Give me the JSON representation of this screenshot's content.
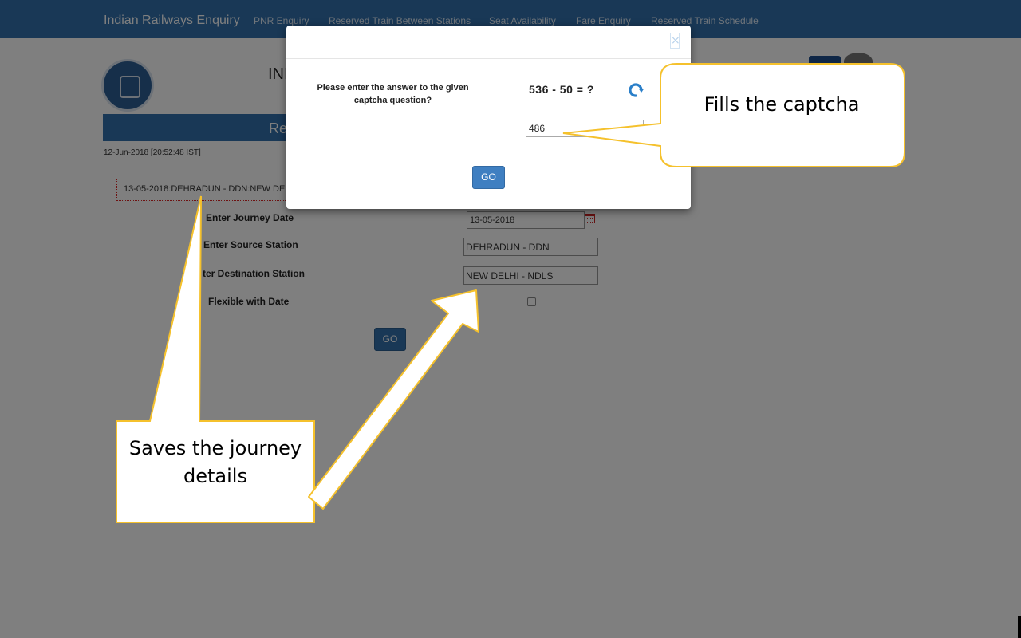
{
  "navbar": {
    "brand": "Indian Railways Enquiry",
    "links": [
      "PNR Enquiry",
      "Reserved Train Between Stations",
      "Seat Availability",
      "Fare Enquiry",
      "Reserved Train Schedule"
    ]
  },
  "page": {
    "heading": "INI",
    "bar_title": "Re",
    "datetime": "12-Jun-2018 [20:52:48 IST]",
    "saved_journey": "13-05-2018:DEHRADUN - DDN:NEW DELHI - NDLS",
    "labels": {
      "journey_date": "Enter Journey Date",
      "source": "Enter Source Station",
      "destination": "ter Destination Station",
      "flexible": "Flexible with Date"
    },
    "values": {
      "journey_date": "13-05-2018",
      "source": "DEHRADUN - DDN",
      "destination": "NEW DELHI - NDLS"
    },
    "go_label": "GO"
  },
  "modal": {
    "close_glyph": "×",
    "prompt": "Please enter the answer to the given captcha question?",
    "question": "536 - 50 = ?",
    "answer": "486",
    "go_label": "GO"
  },
  "callouts": {
    "captcha": "Fills the captcha",
    "journey": "Saves the journey details"
  },
  "colors": {
    "navbar": "#3371ac",
    "button": "#3f7fc1",
    "callout_border": "#f5c12c",
    "overlay": "rgba(0,0,0,0.5)"
  }
}
